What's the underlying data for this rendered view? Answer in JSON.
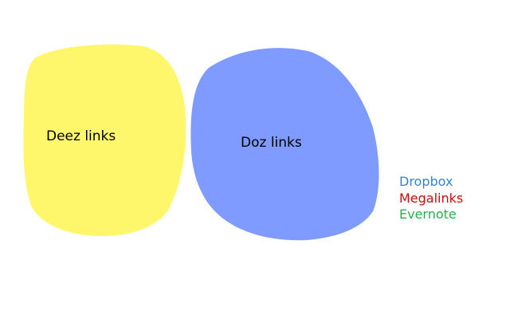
{
  "blobs": {
    "deez": {
      "label": "Deez links",
      "color": "#fff76b"
    },
    "doz": {
      "label": "Doz links",
      "color": "#7f9bff"
    }
  },
  "links": [
    {
      "label": "Dropbox",
      "color": "#2f86d6"
    },
    {
      "label": "Megalinks",
      "color": "#cc0a0a"
    },
    {
      "label": "Evernote",
      "color": "#22b14c"
    }
  ]
}
